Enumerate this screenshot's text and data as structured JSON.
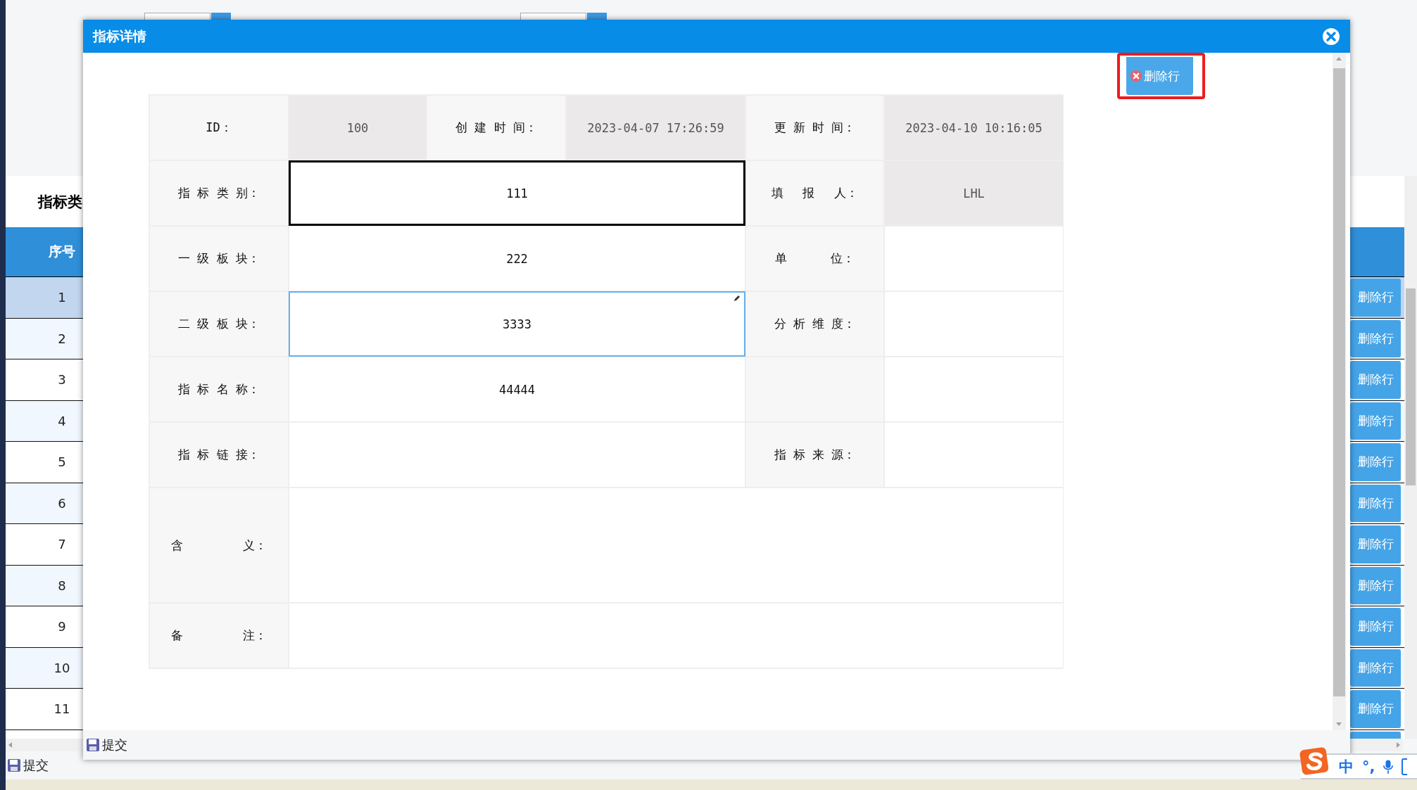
{
  "page": {
    "table_title": "指标类",
    "table": {
      "columns": [
        "序号"
      ],
      "rows": [
        {
          "index": "1",
          "selected": true,
          "action": "删除行"
        },
        {
          "index": "2",
          "selected": false,
          "action": "删除行"
        },
        {
          "index": "3",
          "selected": false,
          "action": "删除行"
        },
        {
          "index": "4",
          "selected": false,
          "action": "删除行"
        },
        {
          "index": "5",
          "selected": false,
          "action": "删除行"
        },
        {
          "index": "6",
          "selected": false,
          "action": "删除行"
        },
        {
          "index": "7",
          "selected": false,
          "action": "删除行"
        },
        {
          "index": "8",
          "selected": false,
          "action": "删除行"
        },
        {
          "index": "9",
          "selected": false,
          "action": "删除行"
        },
        {
          "index": "10",
          "selected": false,
          "action": "删除行"
        },
        {
          "index": "11",
          "selected": false,
          "action": "删除行"
        }
      ]
    },
    "toolbar_button": "提交"
  },
  "ime": {
    "items": [
      "中",
      "°,"
    ]
  },
  "dialog": {
    "title": "指标详情",
    "delete_button": {
      "label": "删除行",
      "highlighted": true
    },
    "form": {
      "rows": [
        {
          "cells": [
            {
              "kind": "label",
              "text": "ID："
            },
            {
              "kind": "value",
              "text": "100",
              "readonly": true,
              "focused": false,
              "editing": false
            },
            {
              "kind": "label",
              "text": "创 建 时 间："
            },
            {
              "kind": "value",
              "text": "2023-04-07 17:26:59",
              "readonly": true,
              "focused": false,
              "editing": false
            },
            {
              "kind": "label",
              "text": "更 新 时 间："
            },
            {
              "kind": "value",
              "text": "2023-04-10 10:16:05",
              "readonly": true,
              "focused": false,
              "editing": false
            }
          ]
        },
        {
          "cells": [
            {
              "kind": "label",
              "text": "指 标 类 别："
            },
            {
              "kind": "value",
              "text": "111",
              "colspan": 3,
              "readonly": false,
              "focused": true,
              "editing": false
            },
            {
              "kind": "label",
              "text": "填　 报　 人："
            },
            {
              "kind": "value",
              "text": "LHL",
              "readonly": true,
              "focused": false,
              "editing": false
            }
          ]
        },
        {
          "cells": [
            {
              "kind": "label",
              "text": "一 级 板 块："
            },
            {
              "kind": "value",
              "text": "222",
              "colspan": 3,
              "readonly": false,
              "focused": false,
              "editing": false
            },
            {
              "kind": "label",
              "text": "单　　　 位："
            },
            {
              "kind": "value",
              "readonly": false,
              "focused": false,
              "editing": false
            }
          ]
        },
        {
          "cells": [
            {
              "kind": "label",
              "text": "二 级 板 块："
            },
            {
              "kind": "value",
              "text": "3333",
              "colspan": 3,
              "readonly": false,
              "focused": false,
              "editing": true
            },
            {
              "kind": "label",
              "text": "分 析 维 度："
            },
            {
              "kind": "value",
              "readonly": false,
              "focused": false,
              "editing": false
            }
          ]
        },
        {
          "cells": [
            {
              "kind": "label",
              "text": "指 标 名 称："
            },
            {
              "kind": "value",
              "text": "44444",
              "colspan": 3,
              "readonly": false,
              "focused": false,
              "editing": false
            },
            {
              "kind": "label"
            },
            {
              "kind": "value",
              "readonly": false,
              "focused": false,
              "editing": false
            }
          ]
        },
        {
          "cells": [
            {
              "kind": "label",
              "text": "指 标 链 接："
            },
            {
              "kind": "value",
              "colspan": 3,
              "readonly": false,
              "focused": false,
              "editing": false
            },
            {
              "kind": "label",
              "text": "指 标 来 源："
            },
            {
              "kind": "value",
              "readonly": false,
              "focused": false,
              "editing": false
            }
          ]
        },
        {
          "cells": [
            {
              "kind": "label",
              "text": "含　　　　　义："
            },
            {
              "kind": "value",
              "colspan": 5,
              "readonly": false,
              "focused": false,
              "editing": false
            }
          ]
        },
        {
          "cells": [
            {
              "kind": "label",
              "text": "备　　　　　注："
            },
            {
              "kind": "value",
              "colspan": 5,
              "readonly": false,
              "focused": false,
              "editing": false
            }
          ]
        }
      ]
    },
    "footer_button": "提交"
  }
}
